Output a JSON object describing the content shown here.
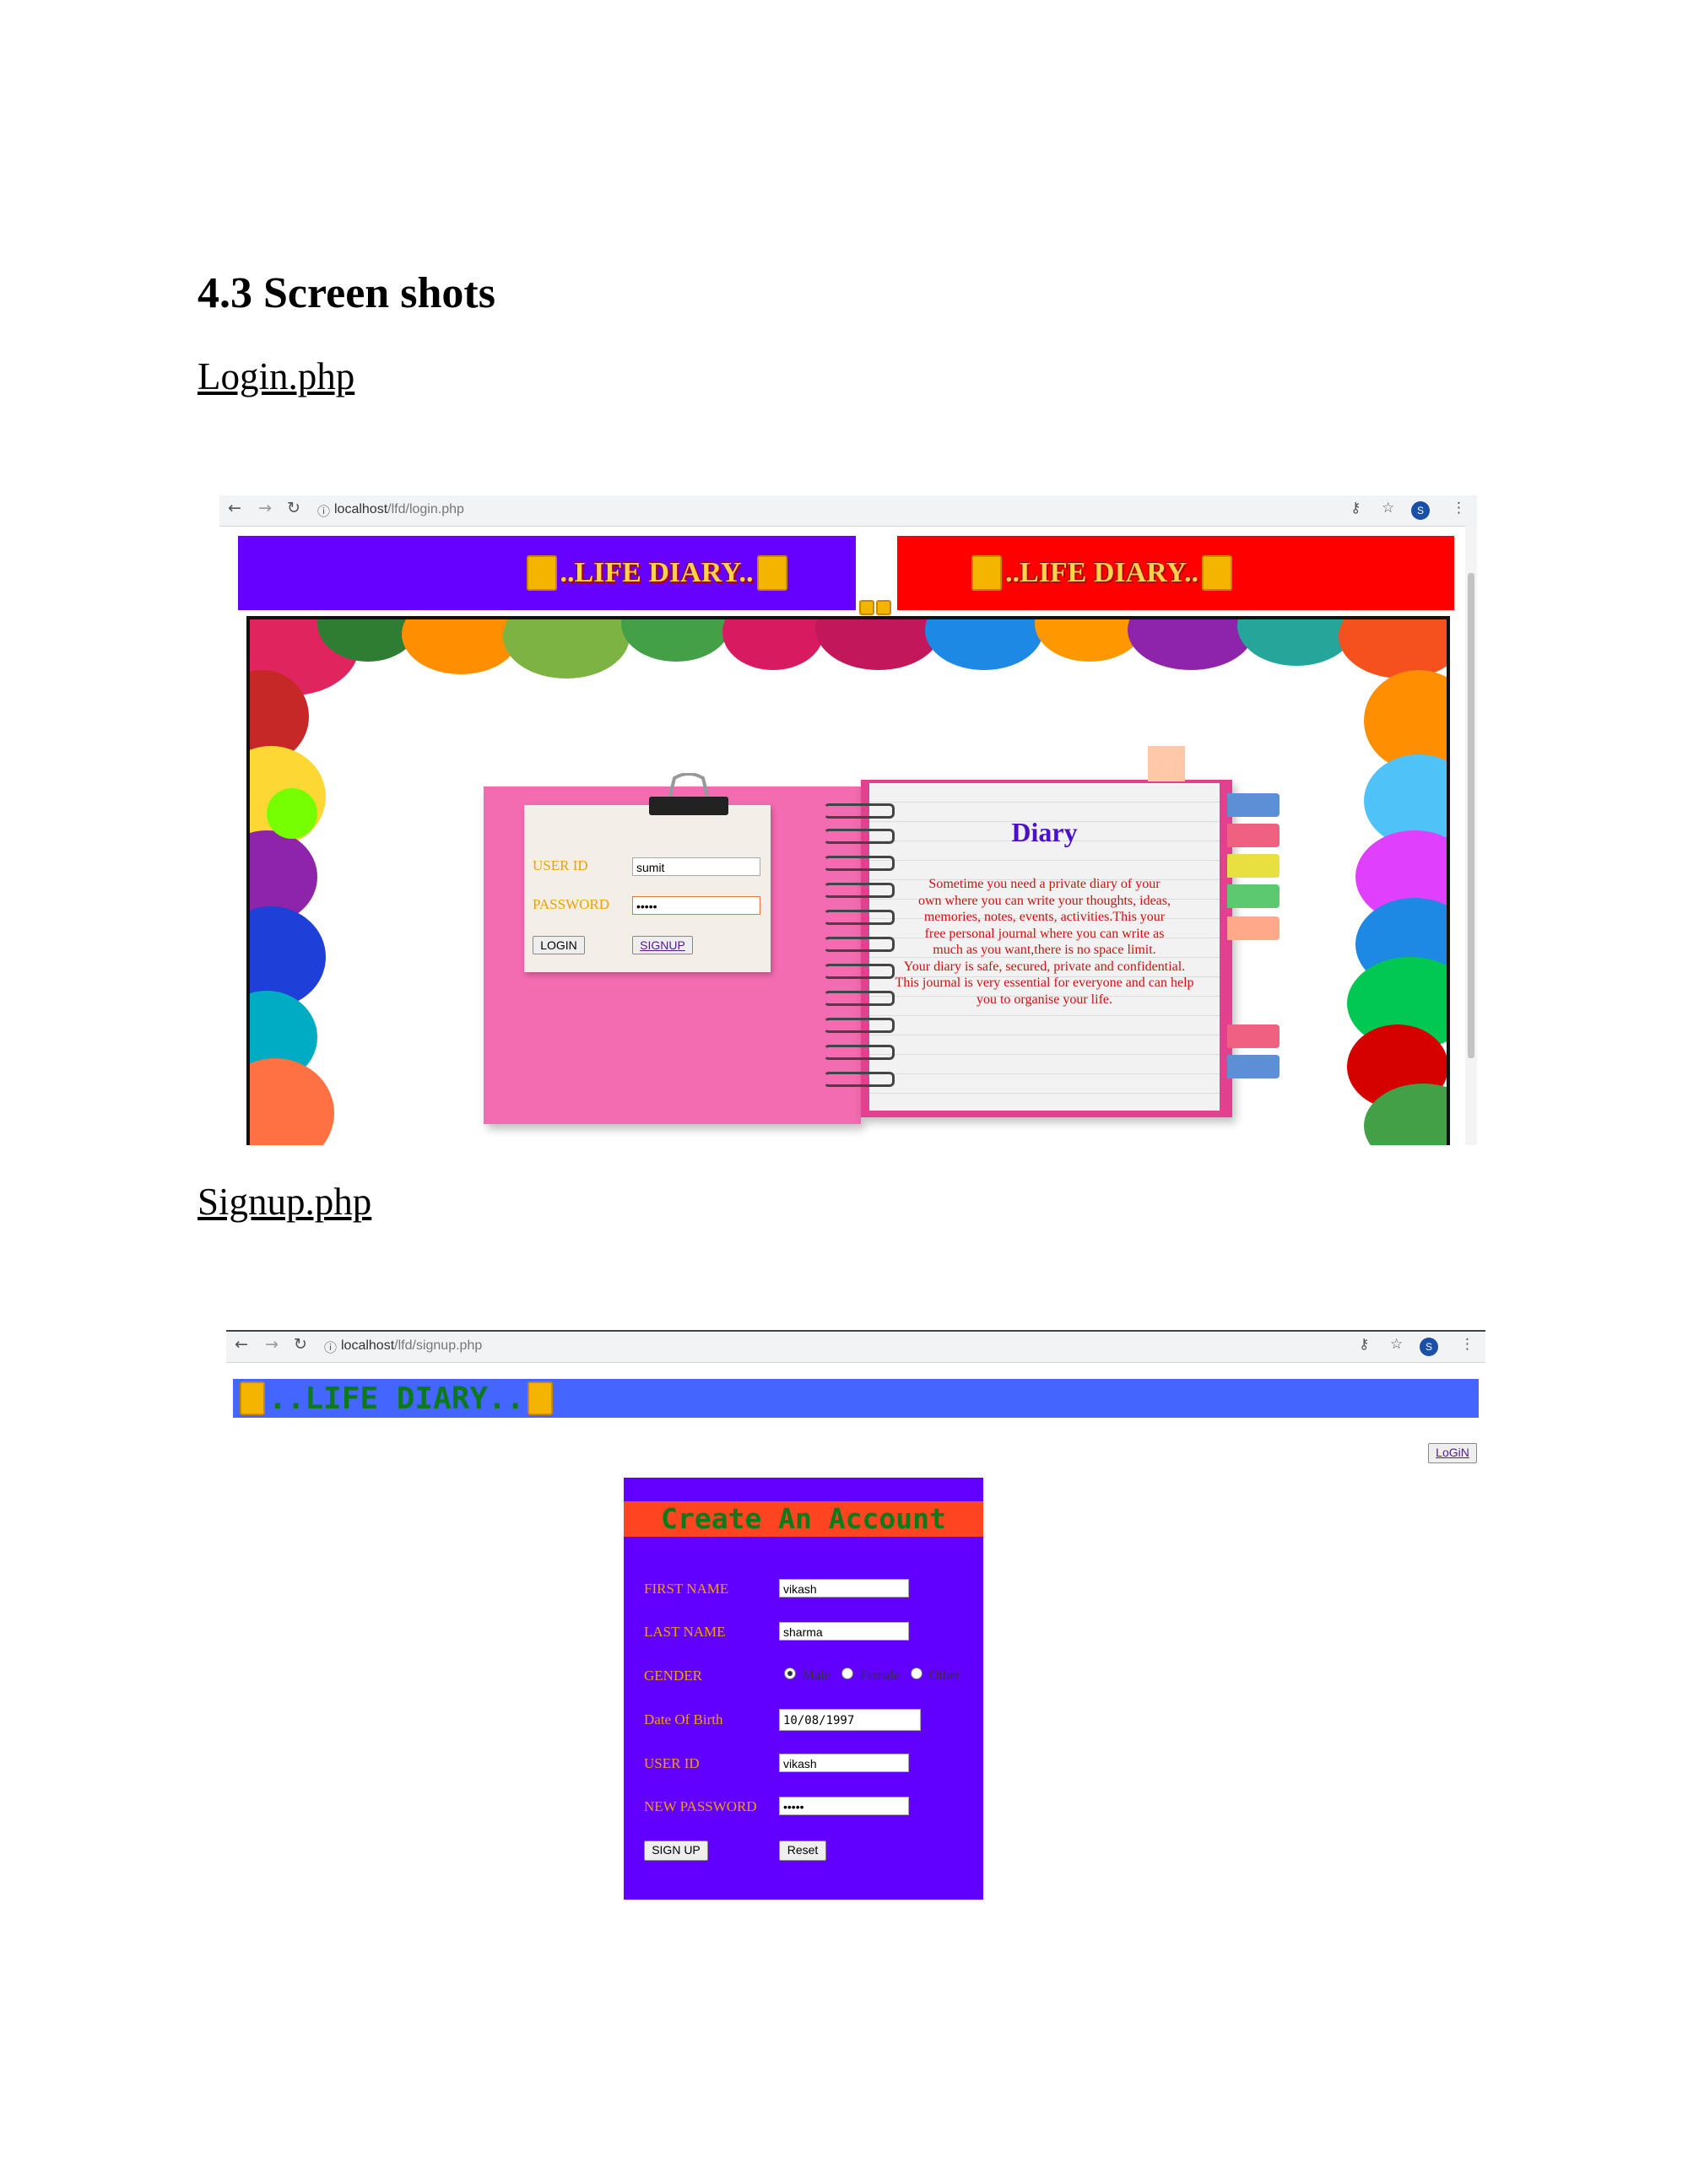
{
  "document": {
    "heading": "4.3 Screen shots",
    "login_caption": "Login.php",
    "signup_caption": "Signup.php"
  },
  "login_screen": {
    "url_host": "localhost",
    "url_path": "/lfd/login.php",
    "profile_initial": "S",
    "banner_text": "..LIFE DIARY..",
    "banner_left_color": "#6600ff",
    "banner_right_color": "#ff0000",
    "form": {
      "user_id_label": "USER ID",
      "user_id_value": "sumit",
      "password_label": "PASSWORD",
      "password_value": "•••••",
      "login_button": "LOGIN",
      "signup_link": "SIGNUP"
    },
    "diary": {
      "title": "Diary",
      "lines": [
        "Sometime you need a private diary of your",
        "own where you can write your thoughts, ideas,",
        "memories, notes, events, activities.This your",
        "free personal journal where you can write as",
        "much as you want,there is no space limit.",
        "Your diary is safe, secured, private and confidential.",
        "This journal is very essential for everyone and can help",
        "you to organise your life."
      ]
    }
  },
  "signup_screen": {
    "url_host": "localhost",
    "url_path": "/lfd/signup.php",
    "profile_initial": "S",
    "banner_text": "..LIFE DIARY..",
    "banner_color": "#4466ff",
    "login_link": "LoGiN",
    "form_title": "Create An Account",
    "fields": {
      "first_name_label": "FIRST NAME",
      "first_name_value": "vikash",
      "last_name_label": "LAST NAME",
      "last_name_value": "sharma",
      "gender_label": "GENDER",
      "gender_options": [
        "Male",
        "Female",
        "Other"
      ],
      "gender_selected": "Male",
      "dob_label": "Date Of Birth",
      "dob_value": "10/08/1997",
      "user_id_label": "USER ID",
      "user_id_value": "vikash",
      "new_password_label": "NEW PASSWORD",
      "new_password_value": "•••••"
    },
    "signup_button": "SIGN UP",
    "reset_button": "Reset"
  }
}
